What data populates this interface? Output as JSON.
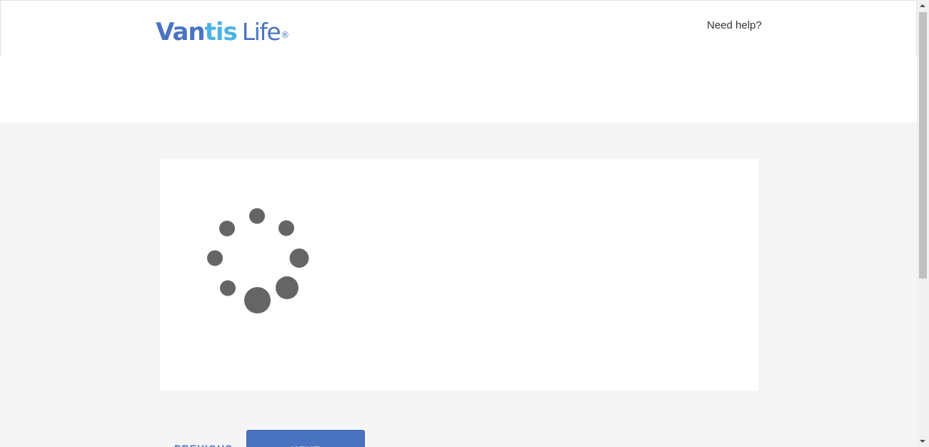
{
  "header": {
    "logo": {
      "part1": "Van",
      "part2": "tis",
      "part3": "Life",
      "registered_mark": "®"
    },
    "help_link": "Need help?"
  },
  "loading": {
    "spinner_icon": "loading-spinner-icon",
    "color": "#656565"
  },
  "nav": {
    "previous_label": "PREVIOUS",
    "next_label": "NEXT"
  },
  "colors": {
    "brand_blue": "#4a74c2",
    "brand_light_blue": "#4bb3e3",
    "page_background": "#f5f5f5",
    "card_background": "#ffffff"
  }
}
